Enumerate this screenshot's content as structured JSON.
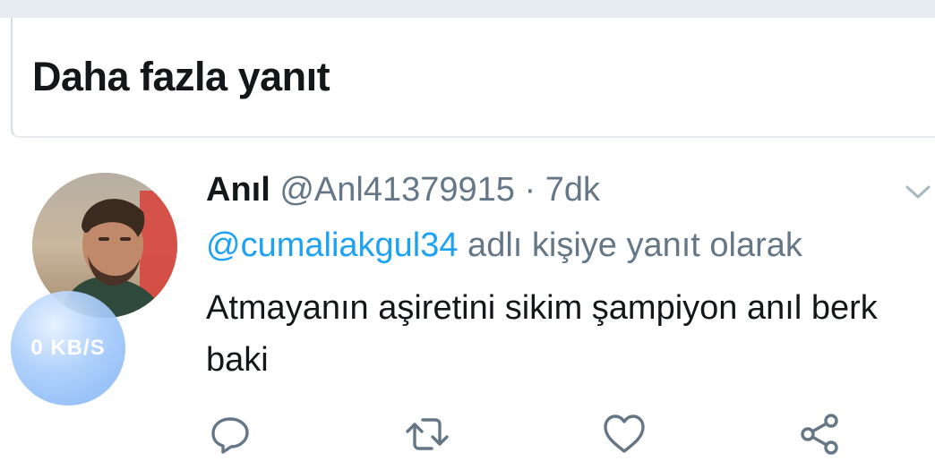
{
  "section": {
    "title": "Daha fazla yanıt"
  },
  "speed_indicator": {
    "label": "0 KB/S"
  },
  "tweet": {
    "display_name": "Anıl",
    "handle": "@Anl41379915",
    "separator": " · ",
    "time": "7dk",
    "reply_to_mention": "@cumaliakgul34",
    "reply_to_suffix": " adlı kişiye yanıt olarak",
    "text": "Atmayanın aşiretini sikim şampiyon anıl berk baki"
  },
  "actions": [
    {
      "name": "reply",
      "icon": "reply-icon"
    },
    {
      "name": "retweet",
      "icon": "retweet-icon"
    },
    {
      "name": "like",
      "icon": "heart-icon"
    },
    {
      "name": "share",
      "icon": "share-icon"
    }
  ],
  "colors": {
    "accent": "#1da1f2",
    "text_primary": "#14171a",
    "text_secondary": "#657786",
    "icon": "#657786",
    "divider": "#e6ecf0"
  }
}
